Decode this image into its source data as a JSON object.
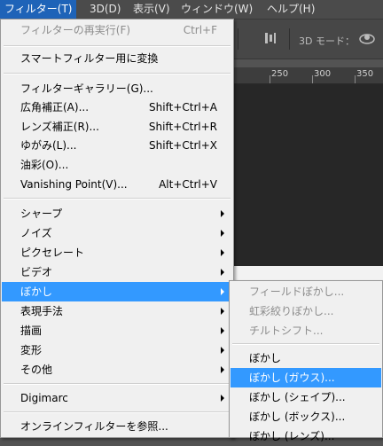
{
  "menubar": {
    "items": [
      "フィルター(T)",
      "3D(D)",
      "表示(V)",
      "ウィンドウ(W)",
      "ヘルプ(H)"
    ]
  },
  "optionsbar": {
    "mode_label": "3D モード："
  },
  "ruler": {
    "labels": [
      "250",
      "300",
      "350"
    ]
  },
  "filter_menu": {
    "items": [
      {
        "label": "フィルターの再実行(F)",
        "shortcut": "Ctrl+F",
        "disabled": true
      },
      {
        "label": "スマートフィルター用に変換"
      },
      {
        "label": "フィルターギャラリー(G)..."
      },
      {
        "label": "広角補正(A)...",
        "shortcut": "Shift+Ctrl+A"
      },
      {
        "label": "レンズ補正(R)...",
        "shortcut": "Shift+Ctrl+R"
      },
      {
        "label": "ゆがみ(L)...",
        "shortcut": "Shift+Ctrl+X"
      },
      {
        "label": "油彩(O)..."
      },
      {
        "label": "Vanishing Point(V)...",
        "shortcut": "Alt+Ctrl+V"
      },
      {
        "label": "シャープ"
      },
      {
        "label": "ノイズ"
      },
      {
        "label": "ピクセレート"
      },
      {
        "label": "ビデオ"
      },
      {
        "label": "ぼかし"
      },
      {
        "label": "表現手法"
      },
      {
        "label": "描画"
      },
      {
        "label": "変形"
      },
      {
        "label": "その他"
      },
      {
        "label": "Digimarc"
      },
      {
        "label": "オンラインフィルターを参照..."
      }
    ]
  },
  "blur_submenu": {
    "items": [
      {
        "label": "フィールドぼかし...",
        "disabled": true
      },
      {
        "label": "虹彩絞りぼかし...",
        "disabled": true
      },
      {
        "label": "チルトシフト...",
        "disabled": true
      },
      {
        "label": "ぼかし"
      },
      {
        "label": "ぼかし (ガウス)..."
      },
      {
        "label": "ぼかし (シェイプ)..."
      },
      {
        "label": "ぼかし (ボックス)..."
      },
      {
        "label": "ぼかし (レンズ)..."
      }
    ]
  }
}
